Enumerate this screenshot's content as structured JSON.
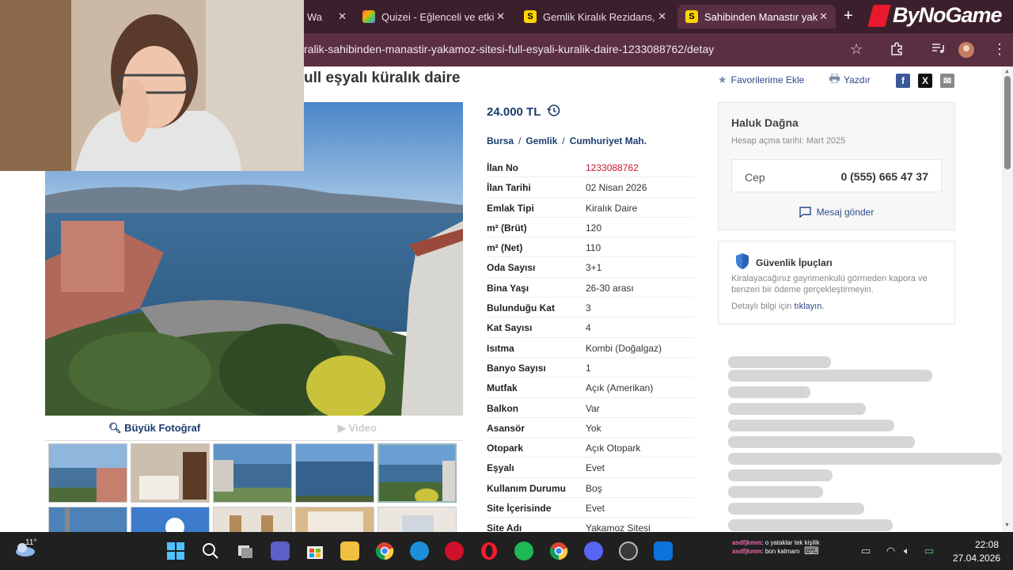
{
  "browser": {
    "tabs": [
      {
        "label": "- Wa",
        "favicon": ""
      },
      {
        "label": "Quizei - Eğlenceli ve etki",
        "favicon": "quizei"
      },
      {
        "label": "Gemlik Kiralık Rezidans, ",
        "favicon": "S"
      },
      {
        "label": "Sahibinden Manastır yak",
        "favicon": "S",
        "active": true
      }
    ],
    "url": "ralik-sahibinden-manastir-yakamoz-sitesi-full-esyali-kuralik-daire-1233088762/detay",
    "logo_text": "ByNoGame"
  },
  "listing": {
    "title": "ull eşyalı küralık daire",
    "actions": {
      "favorite": "Favorilerime Ekle",
      "print": "Yazdır"
    },
    "share": [
      "f",
      "X",
      "✉"
    ],
    "price": "24.000 TL",
    "location": [
      "Bursa",
      "Gemlik",
      "Cumhuriyet Mah."
    ],
    "photo_tabs": {
      "big_photo": "Büyük Fotoğraf",
      "video": "Video"
    },
    "details": [
      {
        "key": "İlan No",
        "value": "1233088762"
      },
      {
        "key": "İlan Tarihi",
        "value": "02 Nisan 2026"
      },
      {
        "key": "Emlak Tipi",
        "value": "Kiralık Daire"
      },
      {
        "key": "m² (Brüt)",
        "value": "120"
      },
      {
        "key": "m² (Net)",
        "value": "110"
      },
      {
        "key": "Oda Sayısı",
        "value": "3+1"
      },
      {
        "key": "Bina Yaşı",
        "value": "26-30 arası"
      },
      {
        "key": "Bulunduğu Kat",
        "value": "3"
      },
      {
        "key": "Kat Sayısı",
        "value": "4"
      },
      {
        "key": "Isıtma",
        "value": "Kombi (Doğalgaz)"
      },
      {
        "key": "Banyo Sayısı",
        "value": "1"
      },
      {
        "key": "Mutfak",
        "value": "Açık (Amerikan)"
      },
      {
        "key": "Balkon",
        "value": "Var"
      },
      {
        "key": "Asansör",
        "value": "Yok"
      },
      {
        "key": "Otopark",
        "value": "Açık Otopark"
      },
      {
        "key": "Eşyalı",
        "value": "Evet"
      },
      {
        "key": "Kullanım Durumu",
        "value": "Boş"
      },
      {
        "key": "Site İçerisinde",
        "value": "Evet"
      },
      {
        "key": "Site Adı",
        "value": "Yakamoz Sitesi"
      }
    ]
  },
  "seller": {
    "name": "Haluk Dağna",
    "since": "Hesap açma tarihi: Mart 2025",
    "phone_label": "Cep",
    "phone": "0 (555) 665 47 37",
    "message": "Mesaj gönder"
  },
  "safety": {
    "title": "Güvenlik İpuçları",
    "text": "Kiralayacağınız gayrimenkulü görmeden kapora ve benzeri bir ödeme gerçekleştirmeyin.",
    "more_prefix": "Detaylı bilgi için ",
    "more_link": "tıklayın."
  },
  "stream_chat": [
    {
      "user": "asdfjkmm",
      "text": "o yataklar tek kişilik"
    },
    {
      "user": "asdfjkmm",
      "text": "bon kalmam"
    }
  ],
  "taskbar": {
    "temperature": "11°",
    "time": "22:08",
    "date": "27.04.2026"
  },
  "colors": {
    "link": "#1a3d6e",
    "id_red": "#c31a2a",
    "browser_frame": "#5a2f42"
  }
}
